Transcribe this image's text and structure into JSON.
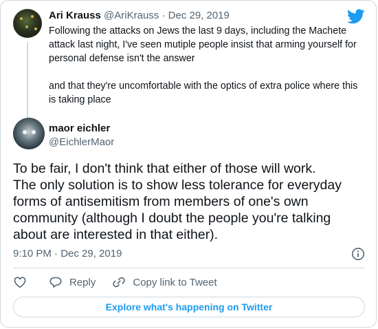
{
  "parent_tweet": {
    "display_name": "Ari Krauss",
    "handle": "@AriKrauss",
    "separator": "·",
    "date": "Dec 29, 2019",
    "paragraphs": [
      "Following the attacks on Jews the last 9 days, including the Machete attack last night, I've seen mutiple people insist that arming yourself for personal defense isn't the answer",
      "and that they're uncomfortable with the optics of extra police where this is taking place"
    ]
  },
  "tweet": {
    "display_name": "maor eichler",
    "handle": "@EichlerMaor",
    "text": "To be fair, I don't think that either of those will work.\nThe only solution is to show less tolerance for everyday forms of antisemitism from members of one's own community (although I doubt the people you're talking about are interested in that either).",
    "timestamp": "9:10 PM · Dec 29, 2019"
  },
  "actions": {
    "reply_label": "Reply",
    "copy_link_label": "Copy link to Tweet"
  },
  "explore_label": "Explore what's happening on Twitter",
  "colors": {
    "brand": "#1d9bf0",
    "secondary_text": "#536471",
    "border": "#cfd9de"
  },
  "icons": [
    "twitter-bird-icon",
    "info-icon",
    "heart-icon",
    "reply-icon",
    "link-icon"
  ]
}
